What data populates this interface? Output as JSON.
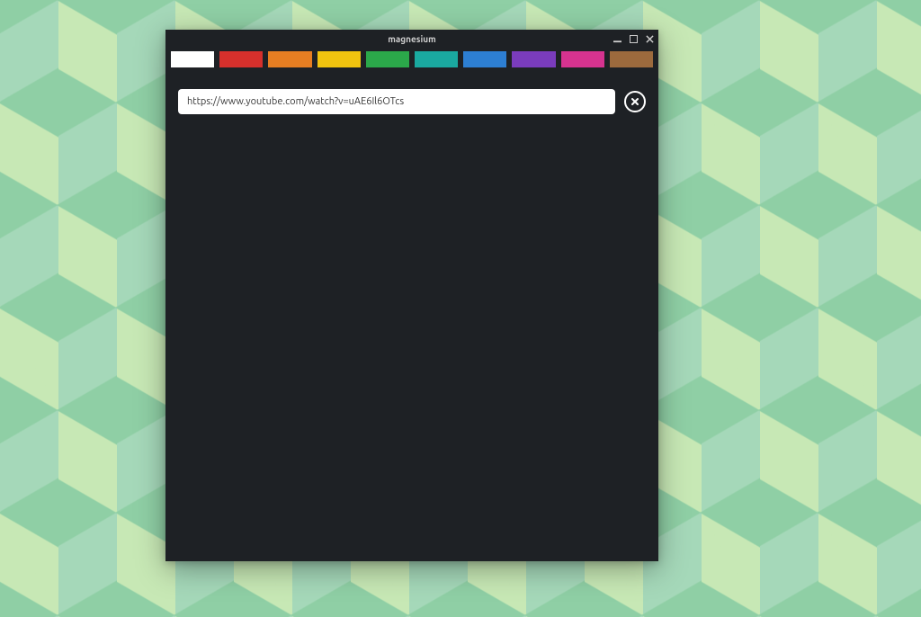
{
  "window": {
    "title": "magnesium"
  },
  "tabs": {
    "colors": [
      "#ffffff",
      "#d6302c",
      "#e67e22",
      "#f1c40f",
      "#2ba84a",
      "#1aa9a0",
      "#2d7fd3",
      "#7a3cbd",
      "#d6338f",
      "#9c6a3d"
    ]
  },
  "url_bar": {
    "value": "https://www.youtube.com/watch?v=uAE6Il6OTcs"
  }
}
